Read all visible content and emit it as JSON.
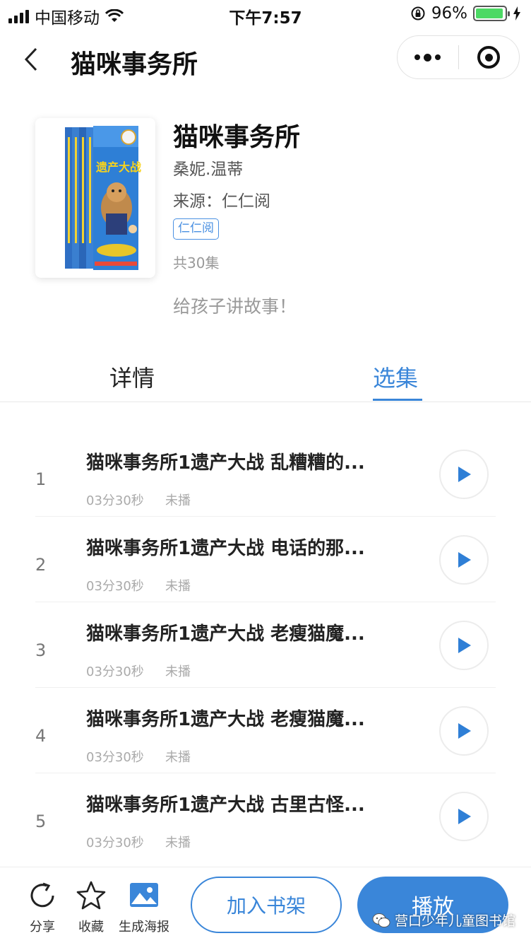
{
  "status_bar": {
    "carrier": "中国移动",
    "time": "下午7:57",
    "battery_percent": "96%",
    "battery_level": 0.96
  },
  "nav": {
    "title": "猫咪事务所"
  },
  "book": {
    "cover_title": "遗产大战",
    "title": "猫咪事务所",
    "author": "桑妮.温蒂",
    "source": "来源：仁仁阅",
    "tag": "仁仁阅",
    "episode_count": "共30集",
    "description": "给孩子讲故事！"
  },
  "tabs": {
    "details": "详情",
    "episodes": "选集"
  },
  "episodes": [
    {
      "num": "1",
      "title": "猫咪事务所1遗产大战 乱糟糟的...",
      "duration": "03分30秒",
      "status": "未播"
    },
    {
      "num": "2",
      "title": "猫咪事务所1遗产大战 电话的那...",
      "duration": "03分30秒",
      "status": "未播"
    },
    {
      "num": "3",
      "title": "猫咪事务所1遗产大战 老瘦猫魔...",
      "duration": "03分30秒",
      "status": "未播"
    },
    {
      "num": "4",
      "title": "猫咪事务所1遗产大战 老瘦猫魔...",
      "duration": "03分30秒",
      "status": "未播"
    },
    {
      "num": "5",
      "title": "猫咪事务所1遗产大战 古里古怪...",
      "duration": "03分30秒",
      "status": "未播"
    }
  ],
  "bottom_bar": {
    "share": "分享",
    "favorite": "收藏",
    "poster": "生成海报",
    "add_to_shelf": "加入书架",
    "play": "播放"
  },
  "watermark": "营口少年儿童图书馆",
  "colors": {
    "accent": "#3a86d9",
    "battery": "#4cd964"
  }
}
